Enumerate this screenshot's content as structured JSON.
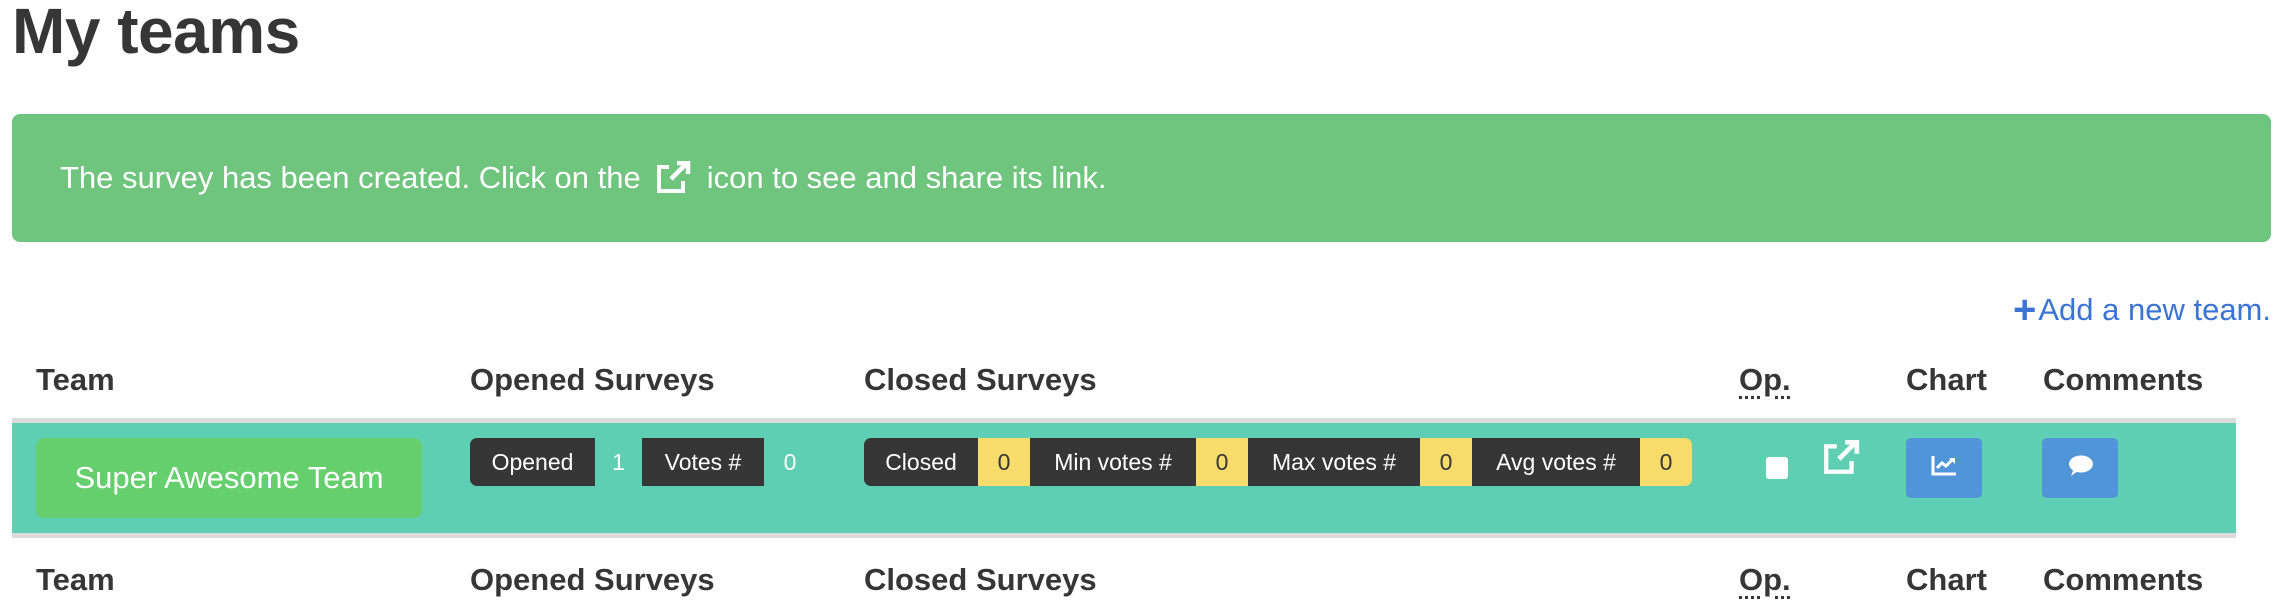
{
  "page": {
    "title": "My teams"
  },
  "alert": {
    "text_before": "The survey has been created. Click on the",
    "icon": "external-link-icon",
    "text_after": "icon to see and share its link.",
    "color": "#6fc47e"
  },
  "actions": {
    "add_team_icon": "plus-icon",
    "add_team_label": "Add a new team."
  },
  "table": {
    "headers": {
      "team": "Team",
      "opened": "Opened Surveys",
      "closed": "Closed Surveys",
      "op": "Op.",
      "chart": "Chart",
      "comments": "Comments"
    },
    "rows": [
      {
        "team": "Super Awesome Team",
        "opened": {
          "opened_label": "Opened",
          "opened_value": "1",
          "votes_label": "Votes #",
          "votes_value": "0"
        },
        "closed": {
          "closed_label": "Closed",
          "closed_value": "0",
          "min_label": "Min votes #",
          "min_value": "0",
          "max_label": "Max votes #",
          "max_value": "0",
          "avg_label": "Avg votes #",
          "avg_value": "0"
        },
        "op_icons": [
          "stop-icon",
          "external-link-icon"
        ],
        "chart_icon": "line-chart-icon",
        "comments_icon": "comment-icon"
      }
    ]
  },
  "colors": {
    "row_bg": "#5ecfb3",
    "team_button": "#65cf6e",
    "action_button": "#4f95d8",
    "tag_dark": "#363636",
    "tag_yellow": "#f7db6b",
    "link": "#3b74d4"
  }
}
